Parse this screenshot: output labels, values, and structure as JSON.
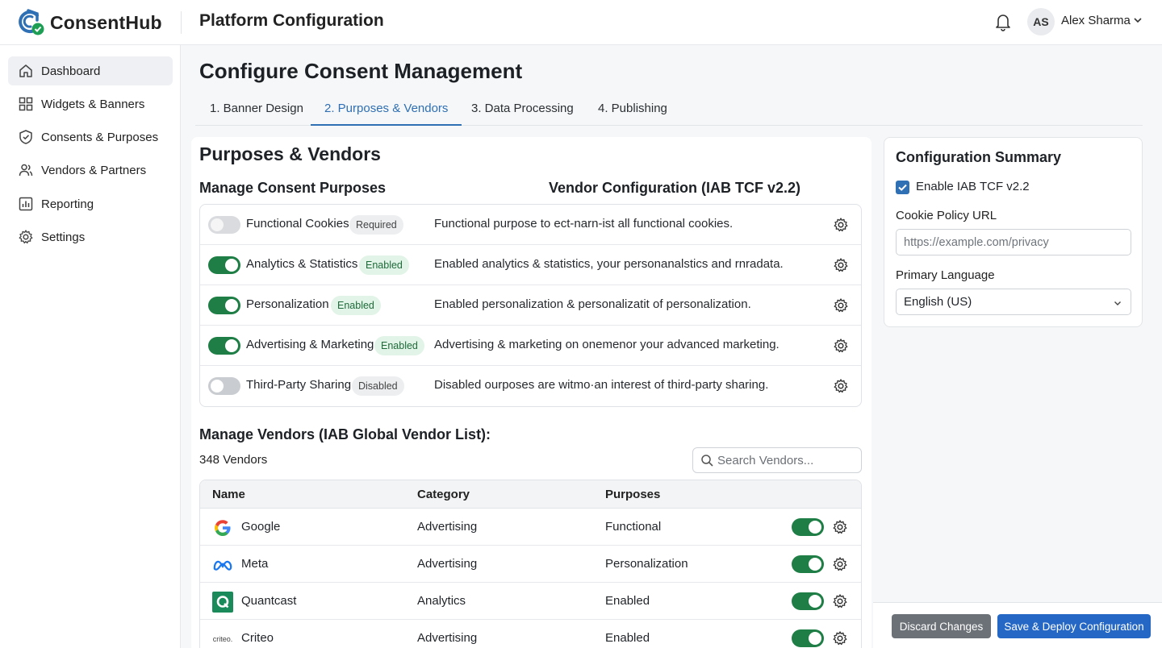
{
  "app": {
    "name": "ConsentHub",
    "page_title": "Platform Configuration"
  },
  "user": {
    "initials": "AS",
    "name": "Alex Sharma"
  },
  "sidebar": {
    "items": [
      {
        "label": "Dashboard",
        "icon": "home-icon",
        "active": true
      },
      {
        "label": "Widgets & Banners",
        "icon": "grid-icon",
        "active": false
      },
      {
        "label": "Consents & Purposes",
        "icon": "shield-check-icon",
        "active": false
      },
      {
        "label": "Vendors & Partners",
        "icon": "users-icon",
        "active": false
      },
      {
        "label": "Reporting",
        "icon": "bar-chart-icon",
        "active": false
      },
      {
        "label": "Settings",
        "icon": "gear-icon",
        "active": false
      }
    ]
  },
  "main": {
    "title": "Configure Consent Management",
    "tabs": [
      {
        "label": "1. Banner Design",
        "active": false
      },
      {
        "label": "2. Purposes & Vendors",
        "active": true
      },
      {
        "label": "3. Data Processing",
        "active": false
      },
      {
        "label": "4. Publishing",
        "active": false
      }
    ],
    "section_title": "Purposes & Vendors",
    "purposes_heading": "Manage Consent Purposes",
    "vendor_config_heading": "Vendor Configuration (IAB TCF v2.2)",
    "purposes": [
      {
        "name": "Functional Cookies",
        "state": "locked",
        "badge": "Required",
        "badge_style": "grey",
        "description": "Functional purpose to ect-narn-ist all functional cookies."
      },
      {
        "name": "Analytics & Statistics",
        "state": "on",
        "badge": "Enabled",
        "badge_style": "green",
        "description": "Enabled analytics & statistics, your personanalstics and rnradata."
      },
      {
        "name": "Personalization",
        "state": "on",
        "badge": "Enabled",
        "badge_style": "green",
        "description": "Enabled personalization & personalizatit of personalization."
      },
      {
        "name": "Advertising & Marketing",
        "state": "on",
        "badge": "Enabled",
        "badge_style": "green",
        "description": "Advertising & marketing on onemenor your advanced marketing."
      },
      {
        "name": "Third-Party Sharing",
        "state": "off",
        "badge": "Disabled",
        "badge_style": "grey",
        "description": "Disabled ourposes are witmo·an interest of third-party sharing."
      }
    ],
    "vendors_heading": "Manage Vendors (IAB Global Vendor List):",
    "vendor_count": "348 Vendors",
    "search_placeholder": "Search Vendors...",
    "vendor_columns": {
      "name": "Name",
      "category": "Category",
      "purposes": "Purposes"
    },
    "vendors": [
      {
        "name": "Google",
        "logo": "google-logo-icon",
        "category": "Advertising",
        "purposes": "Functional",
        "enabled": true
      },
      {
        "name": "Meta",
        "logo": "meta-logo-icon",
        "category": "Advertising",
        "purposes": "Personalization",
        "enabled": true
      },
      {
        "name": "Quantcast",
        "logo": "quantcast-logo-icon",
        "category": "Analytics",
        "purposes": "Enabled",
        "enabled": true
      },
      {
        "name": "Criteo",
        "logo": "criteo-logo-icon",
        "logo_text": "criteo.",
        "category": "Advertising",
        "purposes": "Enabled",
        "enabled": true
      }
    ]
  },
  "summary": {
    "title": "Configuration Summary",
    "enable_tcf_label": "Enable IAB TCF v2.2",
    "enable_tcf_checked": true,
    "cookie_policy_label": "Cookie Policy URL",
    "cookie_policy_placeholder": "https://example.com/privacy",
    "language_label": "Primary Language",
    "language_value": "English (US)"
  },
  "footer": {
    "discard_label": "Discard Changes",
    "save_label": "Save & Deploy Configuration"
  },
  "colors": {
    "primary": "#2467c5",
    "accent_tab": "#2f6fb3",
    "toggle_on": "#1e7e45",
    "badge_green_bg": "#e2f3e7"
  }
}
